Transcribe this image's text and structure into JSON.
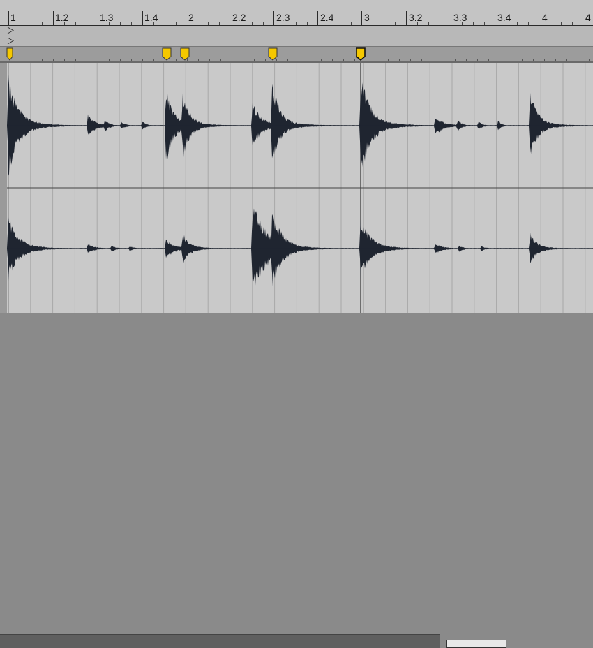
{
  "ruler": {
    "labels": [
      "1",
      "1.2",
      "1.3",
      "1.4",
      "2",
      "2.2",
      "2.3",
      "2.4",
      "3",
      "3.2",
      "3.3",
      "3.4",
      "4",
      "4"
    ]
  },
  "warp_markers": {
    "color": "#f5c800"
  },
  "colors": {
    "waveform": "#1f2530",
    "grid_bar": "#3a3a3a",
    "grid_beat": "#a8a8a8",
    "background": "#c9c9c9"
  },
  "icons": {
    "lane_arrow": "triangle-right-outline-icon",
    "warp_marker": "warp-marker-flag-icon"
  }
}
